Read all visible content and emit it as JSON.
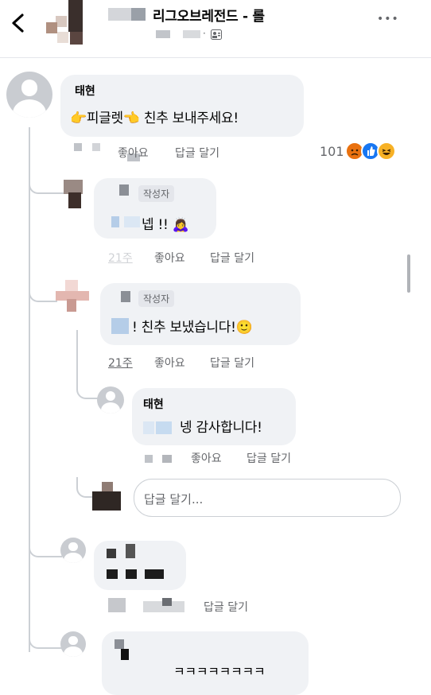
{
  "header": {
    "title": "리그오브레전드 - 롤",
    "subtitle_sep": "·",
    "more": "•••"
  },
  "comments": {
    "c1": {
      "author": "태현",
      "text": "👉피글렛👈 친추 보내주세요!",
      "like": "좋아요",
      "reply": "답글 달기",
      "reaction_count": "101"
    },
    "r1": {
      "badge": "작성자",
      "text": "넵 !! 🙇‍♀️",
      "like": "좋아요",
      "reply": "답글 달기",
      "time": "21주"
    },
    "r2": {
      "badge": "작성자",
      "text": "! 친추 보냈습니다!🙂",
      "like": "좋아요",
      "reply": "답글 달기",
      "time": "21주"
    },
    "r3": {
      "author": "태현",
      "text": "넹 감사합니다!",
      "like": "좋아요",
      "reply": "답글 달기"
    },
    "reply_input_placeholder": "답글 달기...",
    "r4": {
      "reply": "답글 달기"
    },
    "r5": {
      "text": "ㅋㅋㅋㅋㅋㅋㅋㅋ"
    }
  },
  "reaction_icons": [
    "angry-icon",
    "like-icon",
    "haha-icon"
  ]
}
